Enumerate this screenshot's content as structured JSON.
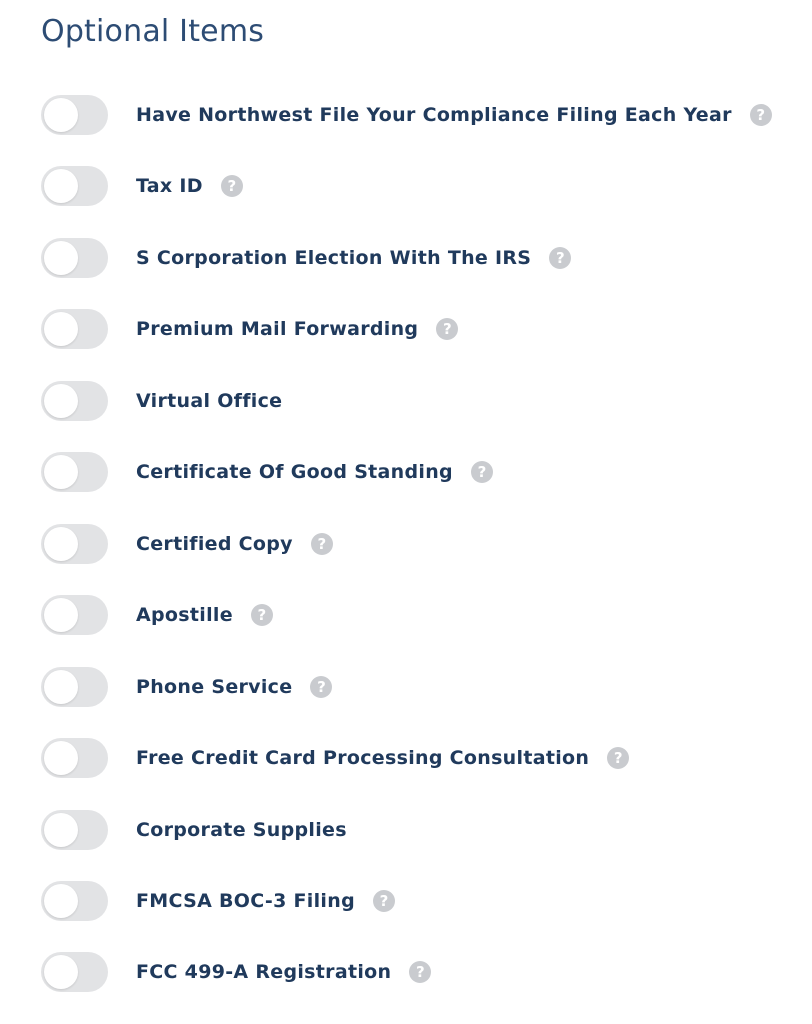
{
  "section": {
    "title": "Optional Items"
  },
  "items": [
    {
      "label": "Have Northwest File Your Compliance Filing Each Year",
      "help": true,
      "enabled": false
    },
    {
      "label": "Tax ID",
      "help": true,
      "enabled": false
    },
    {
      "label": "S Corporation Election With The IRS",
      "help": true,
      "enabled": false
    },
    {
      "label": "Premium Mail Forwarding",
      "help": true,
      "enabled": false
    },
    {
      "label": "Virtual Office",
      "help": false,
      "enabled": false
    },
    {
      "label": "Certificate Of Good Standing",
      "help": true,
      "enabled": false
    },
    {
      "label": "Certified Copy",
      "help": true,
      "enabled": false
    },
    {
      "label": "Apostille",
      "help": true,
      "enabled": false
    },
    {
      "label": "Phone Service",
      "help": true,
      "enabled": false
    },
    {
      "label": "Free Credit Card Processing Consultation",
      "help": true,
      "enabled": false
    },
    {
      "label": "Corporate Supplies",
      "help": false,
      "enabled": false
    },
    {
      "label": "FMCSA BOC-3 Filing",
      "help": true,
      "enabled": false
    },
    {
      "label": "FCC 499-A Registration",
      "help": true,
      "enabled": false
    }
  ],
  "icons": {
    "help": "question-circle-icon"
  },
  "colors": {
    "heading": "#2d4c74",
    "label": "#203a5c",
    "toggle_off": "#e2e3e5",
    "help_icon": "#c9cbcf"
  }
}
